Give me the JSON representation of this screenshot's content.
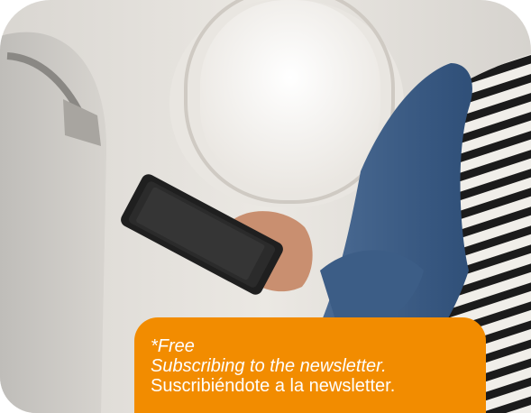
{
  "promo": {
    "free_label": "*Free",
    "headline_en": "Subscribing to the newsletter.",
    "headline_es": "Suscribiéndote a la newsletter."
  },
  "colors": {
    "accent": "#f28c00",
    "text": "#ffffff"
  },
  "image": {
    "subject": "person-holding-smartphone-on-airplane"
  }
}
